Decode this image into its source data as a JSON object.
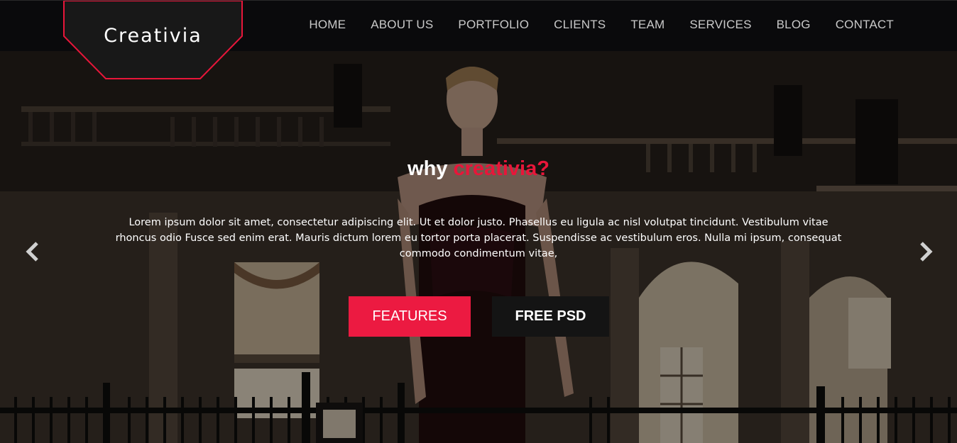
{
  "brand": {
    "name": "Creativia",
    "accent_color": "#ec1a41"
  },
  "nav": {
    "items": [
      "HOME",
      "ABOUT US",
      "PORTFOLIO",
      "CLIENTS",
      "TEAM",
      "SERVICES",
      "BLOG",
      "CONTACT"
    ]
  },
  "hero": {
    "headline_lead": "why",
    "headline_accent": "creativia?",
    "paragraph": "Lorem ipsum dolor sit amet, consectetur adipiscing elit. Ut et dolor justo. Phasellus eu ligula ac nisl volutpat tincidunt. Vestibulum vitae rhoncus odio Fusce sed enim erat. Mauris dictum lorem eu tortor porta placerat. Suspendisse ac vestibulum eros. Nulla mi ipsum, consequat commodo condimentum vitae,",
    "primary_button": "FEATURES",
    "secondary_button": "FREE PSD"
  },
  "carousel": {
    "prev_icon": "chevron-left-icon",
    "next_icon": "chevron-right-icon"
  }
}
